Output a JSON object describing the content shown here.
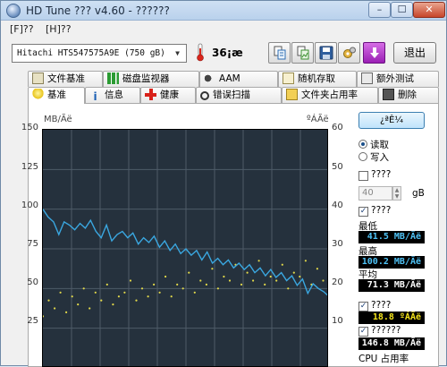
{
  "window": {
    "title": "HD Tune ??? v4.60 - ??????",
    "min": "–",
    "max": "☐",
    "close": "✕"
  },
  "menu": [
    "[F]??",
    "[H]??"
  ],
  "toolbar": {
    "drive": "Hitachi HTS547575A9E    (750 gB)",
    "temperature": "36¡æ",
    "exit_label": "退出",
    "icons": [
      "copy-text-icon",
      "copy-image-icon",
      "save-icon",
      "options-icon",
      "download-icon"
    ]
  },
  "tabs_back": [
    "文件基准",
    "磁盘监视器",
    "AAM",
    "随机存取",
    "额外测试"
  ],
  "tabs_front": [
    "基准",
    "信息",
    "健康",
    "错误扫描",
    "文件夹占用率",
    "删除"
  ],
  "active_tab": "基准",
  "chart": {
    "left_unit": "MB/Ãë",
    "right_unit": "ºÁÃë",
    "left_ticks": [
      "150",
      "125",
      "100",
      "75",
      "50",
      "25"
    ],
    "right_ticks": [
      "60",
      "50",
      "40",
      "30",
      "20",
      "10"
    ],
    "background": "#25313d",
    "grid_color": "#4e5b68",
    "line_color": "#3aa7e0",
    "dot_color": "#e2d94a"
  },
  "chart_data": {
    "type": "line",
    "title": "",
    "xlabel": "",
    "ylabel": "MB/Ãë",
    "y2label": "ºÁÃë",
    "ylim": [
      0,
      150
    ],
    "y2lim": [
      0,
      60
    ],
    "grid": true,
    "series": [
      {
        "axis": "left",
        "values": [
          100,
          95,
          92,
          84,
          92,
          90,
          87,
          91,
          88,
          93,
          86,
          82,
          90,
          80,
          84,
          86,
          82,
          85,
          78,
          82,
          79,
          83,
          76,
          80,
          74,
          78,
          72,
          75,
          71,
          74,
          68,
          73,
          66,
          69,
          65,
          68,
          63,
          66,
          62,
          65,
          60,
          63,
          58,
          62,
          57,
          60,
          55,
          58,
          52,
          56,
          47,
          53,
          50,
          48,
          45
        ]
      },
      {
        "axis": "right",
        "style": "scatter",
        "values": [
          13,
          17,
          15,
          19,
          14,
          18,
          16,
          20,
          15,
          19,
          17,
          21,
          16,
          18,
          19,
          22,
          17,
          20,
          18,
          21,
          19,
          23,
          18,
          21,
          20,
          24,
          19,
          22,
          21,
          25,
          20,
          23,
          22,
          26,
          21,
          24,
          22,
          27,
          21,
          23,
          22,
          26,
          20,
          24,
          23,
          27,
          21,
          25,
          22,
          26
        ]
      }
    ]
  },
  "sidebar": {
    "start_label": "¿ªÊ¼",
    "read_label": "读取",
    "write_label": "写入",
    "short_stroke_label": "????",
    "short_stroke_value": "40",
    "short_stroke_unit": "gB",
    "transfer_label": "????",
    "min_label": "最低",
    "min_value": "41.5 MB/Ãë",
    "max_label": "最高",
    "max_value": "100.2 MB/Ãë",
    "avg_label": "平均",
    "avg_value": "71.3 MB/Ãë",
    "access_label": "????",
    "access_value": "18.8 ºÁÃë",
    "burst_label": "??????",
    "burst_value": "146.8 MB/Ãë",
    "cpu_label": "CPU 占用率"
  }
}
